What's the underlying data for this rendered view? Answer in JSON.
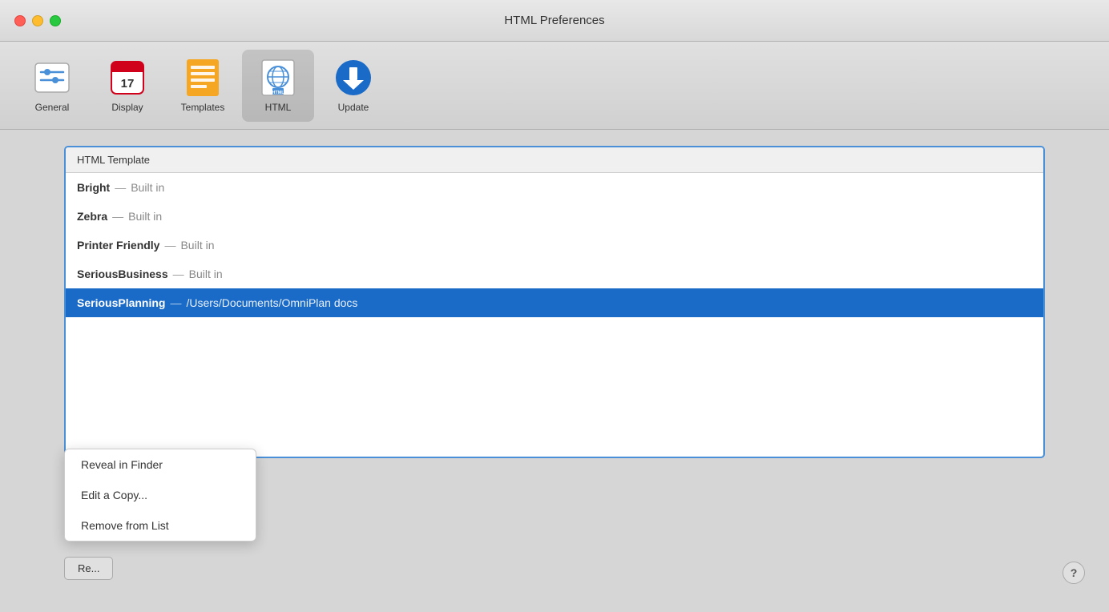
{
  "window": {
    "title": "HTML Preferences"
  },
  "toolbar": {
    "items": [
      {
        "id": "general",
        "label": "General",
        "icon": "sliders-icon"
      },
      {
        "id": "display",
        "label": "Display",
        "icon": "calendar-icon",
        "day": "17"
      },
      {
        "id": "templates",
        "label": "Templates",
        "icon": "list-icon"
      },
      {
        "id": "html",
        "label": "HTML",
        "icon": "html-icon",
        "active": true
      },
      {
        "id": "update",
        "label": "Update",
        "icon": "download-icon"
      }
    ]
  },
  "template_list": {
    "header": "HTML Template",
    "items": [
      {
        "name": "Bright",
        "separator": "—",
        "location": "Built in",
        "selected": false
      },
      {
        "name": "Zebra",
        "separator": "—",
        "location": "Built in",
        "selected": false
      },
      {
        "name": "Printer Friendly",
        "separator": "—",
        "location": "Built in",
        "selected": false
      },
      {
        "name": "SeriousBusiness",
        "separator": "—",
        "location": "Built in",
        "selected": false
      },
      {
        "name": "SeriousPlanning",
        "separator": "—",
        "location": "/Users/Documents/OmniPlan docs",
        "selected": true
      }
    ]
  },
  "gear_button": {
    "label": "⚙",
    "chevron": "▾"
  },
  "dropdown_menu": {
    "items": [
      {
        "label": "Reveal in Finder"
      },
      {
        "label": "Edit a Copy..."
      },
      {
        "label": "Remove from List"
      }
    ]
  },
  "revert_button": {
    "label": "Re..."
  },
  "help_button": {
    "label": "?"
  }
}
